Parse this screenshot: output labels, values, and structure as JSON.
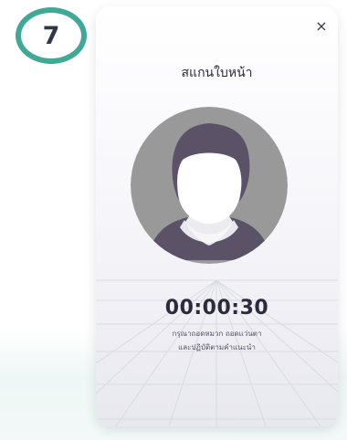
{
  "step_badge": {
    "number": "7",
    "ring_color": "#3fa897"
  },
  "modal": {
    "close_icon": "close-icon",
    "close_label": "×",
    "title": "สแกนใบหน้า",
    "avatar": {
      "icon": "face-placeholder-icon",
      "background_color": "#999999",
      "hair_color": "#5b5268",
      "face_color": "#ffffff"
    },
    "timer": "00:00:30",
    "instructions": [
      "กรุณาถอดหมวก ถอดแว่นตา",
      "และปฏิบัติตามคำแนะนำ"
    ]
  }
}
